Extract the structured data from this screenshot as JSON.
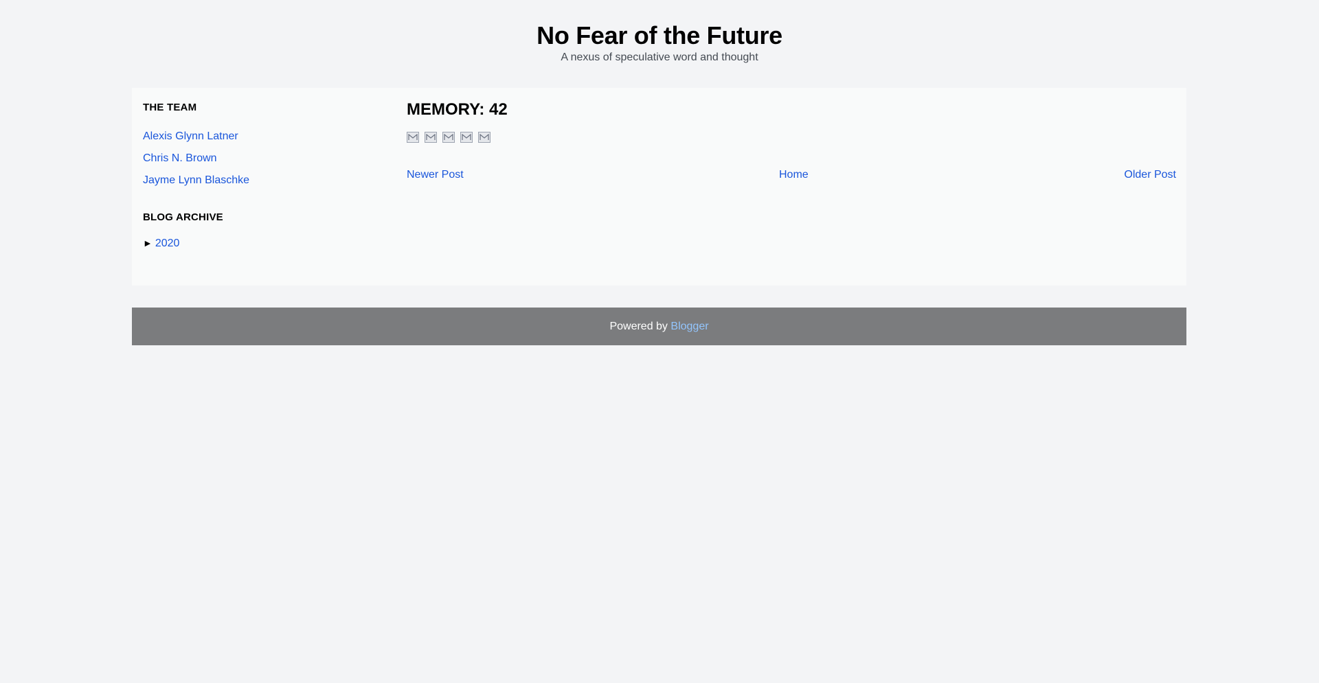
{
  "header": {
    "title": "No Fear of the Future",
    "description": "A nexus of speculative word and thought"
  },
  "sidebar": {
    "team_title": "THE TEAM",
    "team_members": [
      "Alexis Glynn Latner",
      "Chris N. Brown",
      "Jayme Lynn Blaschke"
    ],
    "archive_title": "BLOG ARCHIVE",
    "archive_toggle": "►",
    "archive_year": "2020"
  },
  "post": {
    "title": "MEMORY: 42",
    "share_icons": [
      "email-icon",
      "email-icon",
      "email-icon",
      "email-icon",
      "email-icon"
    ]
  },
  "post_nav": {
    "newer": "Newer Post",
    "home": "Home",
    "older": "Older Post"
  },
  "footer": {
    "prefix": "Powered by",
    "link": "Blogger"
  },
  "colors": {
    "background": "#f3f4f6",
    "content_background": "#f9fafa",
    "link": "#1a56db",
    "footer_background": "#7b7c7e",
    "footer_link": "#93c5fd"
  }
}
